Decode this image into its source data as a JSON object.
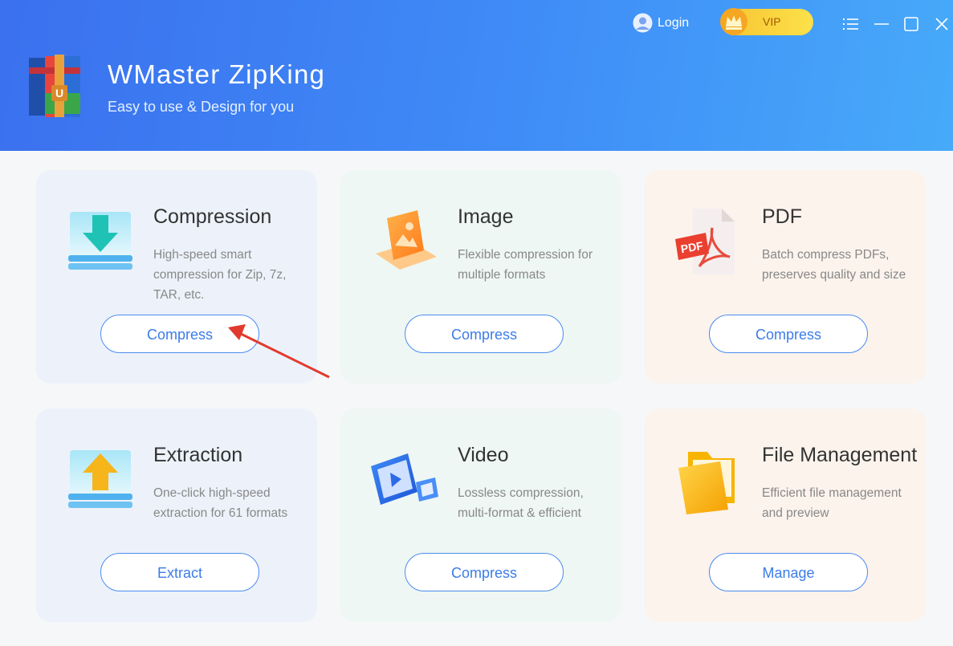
{
  "header": {
    "app_title": "WMaster ZipKing",
    "app_subtitle": "Easy to use & Design for you",
    "login_label": "Login",
    "vip_label": "VIP"
  },
  "colors": {
    "header_start": "#3b70ee",
    "header_end": "#47aaf9",
    "button_border": "#4b8bf0",
    "button_text": "#3b7ce9",
    "vip_yellow": "#f6c431",
    "annotation_arrow": "#e23a2e"
  },
  "cards": [
    {
      "id": "compression",
      "title": "Compression",
      "description": "High-speed smart compression for Zip, 7z, TAR, etc.",
      "button": "Compress",
      "icon": "download-tray-icon"
    },
    {
      "id": "image",
      "title": "Image",
      "description": "Flexible compression for multiple formats",
      "button": "Compress",
      "icon": "image-icon"
    },
    {
      "id": "pdf",
      "title": "PDF",
      "description": "Batch compress PDFs, preserves quality and size",
      "button": "Compress",
      "icon": "pdf-icon"
    },
    {
      "id": "extraction",
      "title": "Extraction",
      "description": "One-click high-speed extraction for 61 formats",
      "button": "Extract",
      "icon": "upload-tray-icon"
    },
    {
      "id": "video",
      "title": "Video",
      "description": "Lossless compression, multi-format & efficient",
      "button": "Compress",
      "icon": "video-icon"
    },
    {
      "id": "file-management",
      "title": "File Management",
      "description": "Efficient file management and preview",
      "button": "Manage",
      "icon": "folder-icon"
    }
  ]
}
